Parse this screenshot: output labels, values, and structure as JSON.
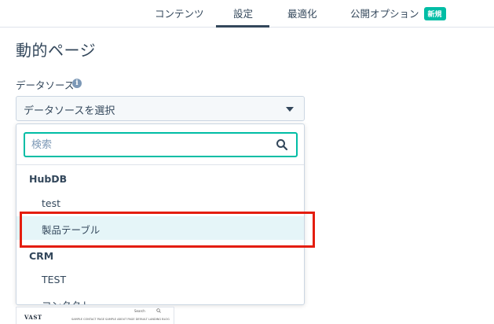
{
  "tabs": [
    {
      "label": "コンテンツ"
    },
    {
      "label": "設定",
      "active": true
    },
    {
      "label": "最適化"
    },
    {
      "label": "公開オプション",
      "badge": "新規"
    }
  ],
  "page": {
    "title": "動的ページ"
  },
  "data_source": {
    "label": "データソース",
    "info_icon": "i",
    "selected": "データソースを選択"
  },
  "dropdown": {
    "search_placeholder": "検索",
    "groups": [
      {
        "label": "HubDB",
        "items": [
          "test",
          "製品テーブル"
        ]
      },
      {
        "label": "CRM",
        "items": [
          "TEST",
          "コンタクト"
        ]
      }
    ]
  },
  "preview": {
    "logo": "VAST",
    "search": "Search",
    "nav": "SAMPLE CONTACT PAGE   SAMPLE ABOUT PAGE   DEFAULT LANDING BLOG"
  },
  "colors": {
    "accent": "#00bda5",
    "highlight_box": "#e41d0e",
    "text": "#33475b"
  }
}
